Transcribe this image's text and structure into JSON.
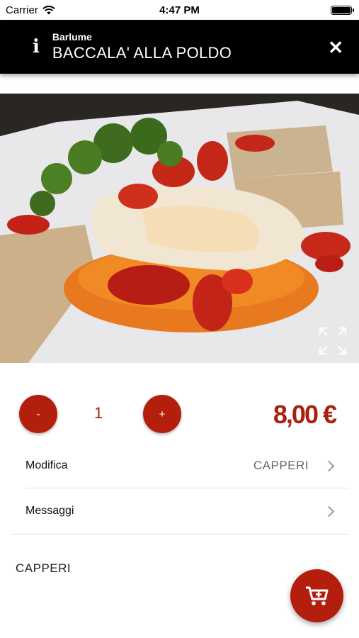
{
  "status_bar": {
    "carrier": "Carrier",
    "time": "4:47 PM"
  },
  "header": {
    "subtitle": "Barlume",
    "title": "BACCALA' ALLA POLDO"
  },
  "quantity": {
    "minus_label": "-",
    "value": "1",
    "plus_label": "+"
  },
  "price": "8,00 €",
  "rows": [
    {
      "label": "Modifica",
      "value": "CAPPERI"
    },
    {
      "label": "Messaggi",
      "value": ""
    }
  ],
  "notes": "CAPPERI",
  "colors": {
    "accent": "#b41e0c",
    "price": "#a8200e",
    "header_bg": "#000000"
  },
  "icons": [
    "info-icon",
    "close-icon",
    "expand-icon",
    "chevron-right-icon",
    "add-to-cart-icon",
    "wifi-icon",
    "battery-icon"
  ]
}
